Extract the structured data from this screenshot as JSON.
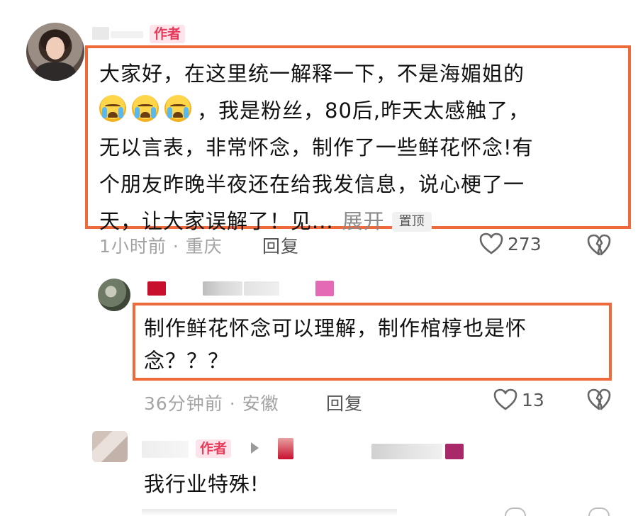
{
  "author_badge": "作者",
  "comments": [
    {
      "text_line1": "大家好，在这里统一解释一下，不是海媚姐的",
      "text_line2": "，我是粉丝，80后,昨天太感触了，",
      "text_line3": "无以言表，非常怀念，制作了一些鲜花怀念!有",
      "text_line4": "个朋友昨晚半夜还在给我发信息，说心梗了一",
      "text_line5": "天，让大家误解了！见...",
      "expand_label": "展开",
      "pin_label": "置顶",
      "emoji_icon": "loudly-crying-face",
      "meta": "1小时前 · 重庆",
      "reply_label": "回复",
      "like_count": "273"
    },
    {
      "text_line1": "制作鲜花怀念可以理解，制作棺椁也是怀",
      "text_line2": "念？？？",
      "meta": "36分钟前 · 安徽",
      "reply_label": "回复",
      "like_count": "13"
    },
    {
      "text": "我行业特殊!"
    }
  ],
  "colors": {
    "highlight_frame": "#ef6a3b",
    "author_badge_text": "#e83a5a",
    "author_badge_bg": "#fce4ea",
    "meta_text": "#a3a3a3"
  }
}
